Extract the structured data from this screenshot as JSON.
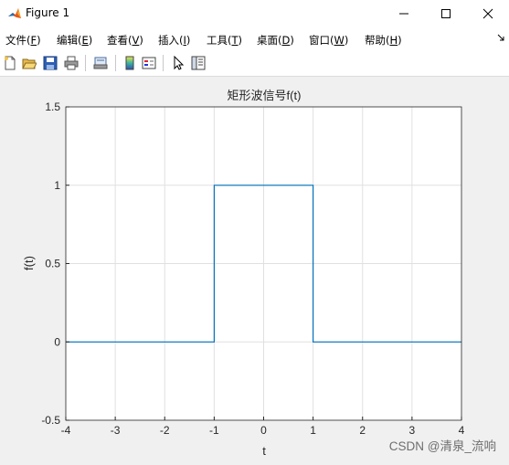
{
  "window": {
    "title": "Figure 1"
  },
  "menu": {
    "items": [
      {
        "label": "文件(",
        "key": "F",
        "end": ")"
      },
      {
        "label": "编辑(",
        "key": "E",
        "end": ")"
      },
      {
        "label": "查看(",
        "key": "V",
        "end": ")"
      },
      {
        "label": "插入(",
        "key": "I",
        "end": ")"
      },
      {
        "label": "工具(",
        "key": "T",
        "end": ")"
      },
      {
        "label": "桌面(",
        "key": "D",
        "end": ")"
      },
      {
        "label": "窗口(",
        "key": "W",
        "end": ")"
      },
      {
        "label": "帮助(",
        "key": "H",
        "end": ")"
      }
    ]
  },
  "toolbar": {
    "buttons": [
      "new-figure-icon",
      "open-file-icon",
      "save-icon",
      "print-icon",
      "print-preview-icon",
      "colorbar-icon",
      "legend-icon",
      "pointer-icon",
      "property-editor-icon"
    ]
  },
  "chart_data": {
    "type": "line",
    "title": "矩形波信号f(t)",
    "xlabel": "t",
    "ylabel": "f(t)",
    "xlim": [
      -4,
      4
    ],
    "ylim": [
      -0.5,
      1.5
    ],
    "xticks": [
      "-4",
      "-3",
      "-2",
      "-1",
      "0",
      "1",
      "2",
      "3",
      "4"
    ],
    "yticks": [
      "-0.5",
      "0",
      "0.5",
      "1",
      "1.5"
    ],
    "grid": true,
    "series": [
      {
        "color": "#0072BD",
        "x": [
          -4,
          -1,
          -1,
          1,
          1,
          4
        ],
        "y": [
          0,
          0,
          1,
          1,
          0,
          0
        ]
      }
    ]
  },
  "watermark": "CSDN @清泉_流响"
}
